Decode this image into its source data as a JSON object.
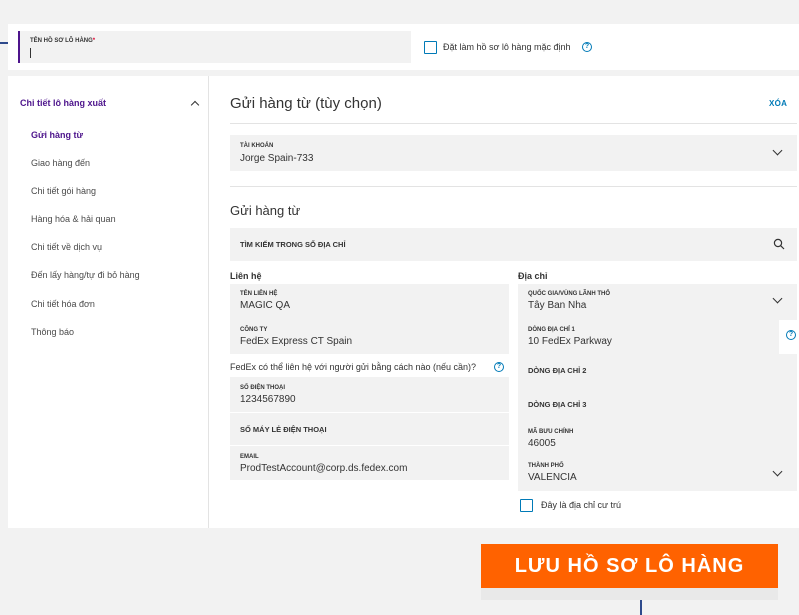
{
  "profile": {
    "name_label": "TÊN HỒ SƠ LÔ HÀNG",
    "required_mark": "*",
    "name_value": "",
    "default_checkbox_label": "Đặt làm hồ sơ lô hàng mặc định"
  },
  "sidebar": {
    "header": "Chi tiết lô hàng xuất",
    "items": [
      {
        "label": "Gửi hàng từ",
        "active": true
      },
      {
        "label": "Giao hàng đến"
      },
      {
        "label": "Chi tiết gói hàng"
      },
      {
        "label": "Hàng hóa & hải quan"
      },
      {
        "label": "Chi tiết về dịch vụ"
      },
      {
        "label": "Đến lấy hàng/tự đi bỏ hàng"
      },
      {
        "label": "Chi tiết hóa đơn"
      },
      {
        "label": "Thông báo"
      }
    ]
  },
  "main": {
    "title": "Gửi hàng từ (tùy chọn)",
    "clear_label": "XÓA",
    "account": {
      "label": "TÀI KHOẢN",
      "value": "Jorge Spain-733"
    },
    "ship_from_title": "Gửi hàng từ",
    "address_search_label": "TÌM KIẾM TRONG SỔ ĐỊA CHỈ",
    "contact": {
      "heading": "Liên hệ",
      "name_label": "TÊN LIÊN HỆ",
      "name_value": "MAGIC QA",
      "company_label": "CÔNG TY",
      "company_value": "FedEx Express CT Spain",
      "question": "FedEx có thể liên hệ với người gửi bằng cách nào (nếu cần)?",
      "phone_label": "SỐ ĐIỆN THOẠI",
      "phone_value": "1234567890",
      "ext_label": "SỐ MÁY LẺ ĐIỆN THOẠI",
      "email_label": "EMAIL",
      "email_value": "ProdTestAccount@corp.ds.fedex.com"
    },
    "address": {
      "heading": "Địa chỉ",
      "country_label": "QUỐC GIA/VÙNG LÃNH THỔ",
      "country_value": "Tây Ban Nha",
      "line1_label": "DÒNG ĐỊA CHỈ 1",
      "line1_value": "10 FedEx Parkway",
      "line2_label": "DÒNG ĐỊA CHỈ 2",
      "line3_label": "DÒNG ĐỊA CHỈ 3",
      "postal_label": "MÃ BƯU CHÍNH",
      "postal_value": "46005",
      "city_label": "THÀNH PHỐ",
      "city_value": "VALENCIA",
      "residential_label": "Đây là địa chỉ cư trú"
    }
  },
  "save_button_label": "LƯU HỒ SƠ LÔ HÀNG",
  "colors": {
    "brand_purple": "#4d148c",
    "fedex_orange": "#ff6200",
    "link_blue": "#007ab7",
    "field_gray": "#f2f2f2"
  },
  "icons": [
    "help-icon",
    "chevron-up-icon",
    "chevron-down-icon",
    "search-icon",
    "checkbox-icon"
  ]
}
